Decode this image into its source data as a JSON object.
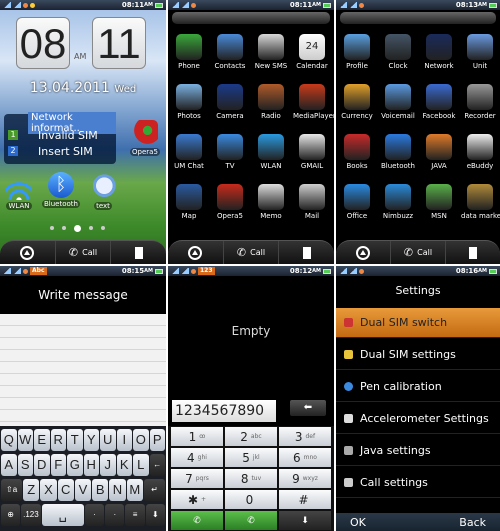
{
  "panels": {
    "home": {
      "status_time": "08:11",
      "status_ampm": "AM",
      "clock_hour": "08",
      "clock_minute": "11",
      "clock_ampm": "AM",
      "date": "13.04.2011",
      "weekday": "Wed",
      "network_widget": {
        "title": "Network informat..",
        "sims": [
          {
            "num": "1",
            "label": "Invalid SIM",
            "color": "#4a9a2a"
          },
          {
            "num": "2",
            "label": "Insert SIM",
            "color": "#2a6ad0"
          }
        ]
      },
      "apps": [
        {
          "label": "Opera5",
          "icon": "opera-icon"
        },
        {
          "label": "WLAN",
          "icon": "wifi-icon"
        },
        {
          "label": "Bluetooth",
          "icon": "bluetooth-icon"
        },
        {
          "label": "text",
          "icon": "chat-bubble-icon"
        }
      ],
      "page_dots": 5,
      "active_page": 3
    },
    "menu1": {
      "status_time": "08:11",
      "status_ampm": "AM",
      "apps": [
        {
          "label": "Phone",
          "color": "#3aa83a"
        },
        {
          "label": "Contacts",
          "color": "#4a8ad8"
        },
        {
          "label": "New SMS",
          "color": "#d8d8d8"
        },
        {
          "label": "Calendar",
          "color": "#cccccc",
          "badge": "24"
        },
        {
          "label": "Photos",
          "color": "#7ab0e0"
        },
        {
          "label": "Camera",
          "color": "#1a3a8a"
        },
        {
          "label": "Radio",
          "color": "#b05a2a"
        },
        {
          "label": "MediaPlayer",
          "color": "#c83a1a"
        },
        {
          "label": "UM Chat",
          "color": "#3a7ad0"
        },
        {
          "label": "TV",
          "color": "#3a8ae0"
        },
        {
          "label": "WLAN",
          "color": "#2a9ae0"
        },
        {
          "label": "GMAIL",
          "color": "#e8e8e8"
        },
        {
          "label": "Map",
          "color": "#2a5aa0"
        },
        {
          "label": "Opera5",
          "color": "#c82a1a"
        },
        {
          "label": "Memo",
          "color": "#dddddd"
        },
        {
          "label": "Mail",
          "color": "#cfcfcf"
        }
      ]
    },
    "menu2": {
      "status_time": "08:13",
      "status_ampm": "AM",
      "apps": [
        {
          "label": "Profile",
          "color": "#5aa0e0"
        },
        {
          "label": "Clock",
          "color": "#445566"
        },
        {
          "label": "Network",
          "color": "#1a2a5a"
        },
        {
          "label": "Unit",
          "color": "#6a9ae0"
        },
        {
          "label": "Currency",
          "color": "#e0a02a"
        },
        {
          "label": "Voicemail",
          "color": "#5a9ae0"
        },
        {
          "label": "Facebook",
          "color": "#3a6ad0"
        },
        {
          "label": "Recorder",
          "color": "#999999"
        },
        {
          "label": "Books",
          "color": "#c82a2a"
        },
        {
          "label": "Bluetooth",
          "color": "#2a7ae0"
        },
        {
          "label": "JAVA",
          "color": "#e07a2a"
        },
        {
          "label": "eBuddy",
          "color": "#eeeeee"
        },
        {
          "label": "Office",
          "color": "#2a8ae0"
        },
        {
          "label": "Nimbuzz",
          "color": "#2a8ad8"
        },
        {
          "label": "MSN",
          "color": "#5ab04a"
        },
        {
          "label": "data marker",
          "color": "#b08a3a"
        }
      ]
    },
    "dock": {
      "call_label": "Call"
    },
    "write": {
      "status_time": "08:15",
      "status_ampm": "AM",
      "status_badge": "Abc",
      "title": "Write message",
      "keyboard": {
        "row1": [
          "Q",
          "W",
          "E",
          "R",
          "T",
          "Y",
          "U",
          "I",
          "O",
          "P"
        ],
        "row2": [
          "A",
          "S",
          "D",
          "F",
          "G",
          "H",
          "J",
          "K",
          "L",
          "←"
        ],
        "row3": [
          "⇧a",
          "Z",
          "X",
          "C",
          "V",
          "B",
          "N",
          "M",
          "↵"
        ],
        "row4": [
          "⊕",
          ".123",
          "␣",
          "·",
          "·",
          "≡",
          "⬇"
        ]
      }
    },
    "dialer": {
      "status_time": "08:12",
      "status_ampm": "AM",
      "status_badge": "123",
      "empty_label": "Empty",
      "number": "1234567890",
      "keys": [
        {
          "d": "1",
          "s": "ꝏ"
        },
        {
          "d": "2",
          "s": "abc"
        },
        {
          "d": "3",
          "s": "def"
        },
        {
          "d": "4",
          "s": "ghi"
        },
        {
          "d": "5",
          "s": "jkl"
        },
        {
          "d": "6",
          "s": "mno"
        },
        {
          "d": "7",
          "s": "pqrs"
        },
        {
          "d": "8",
          "s": "tuv"
        },
        {
          "d": "9",
          "s": "wxyz"
        },
        {
          "d": "✱",
          "s": "+"
        },
        {
          "d": "0",
          "s": ""
        },
        {
          "d": "#",
          "s": ""
        }
      ]
    },
    "settings": {
      "status_time": "08:16",
      "status_ampm": "AM",
      "title": "Settings",
      "items": [
        {
          "label": "Dual SIM switch",
          "selected": true,
          "icon": "sim-switch-icon",
          "color": "#c33"
        },
        {
          "label": "Dual SIM settings",
          "icon": "sim-settings-icon",
          "color": "#e8c43a"
        },
        {
          "label": "Pen calibration",
          "icon": "pen-calibration-icon",
          "color": "#3a8ae0"
        },
        {
          "label": "Accelerometer Settings",
          "icon": "accelerometer-icon",
          "color": "#ddd"
        },
        {
          "label": "Java settings",
          "icon": "java-icon",
          "color": "#aaa"
        },
        {
          "label": "Call settings",
          "icon": "call-settings-icon",
          "color": "#ccc"
        }
      ],
      "ok_label": "OK",
      "back_label": "Back"
    }
  }
}
